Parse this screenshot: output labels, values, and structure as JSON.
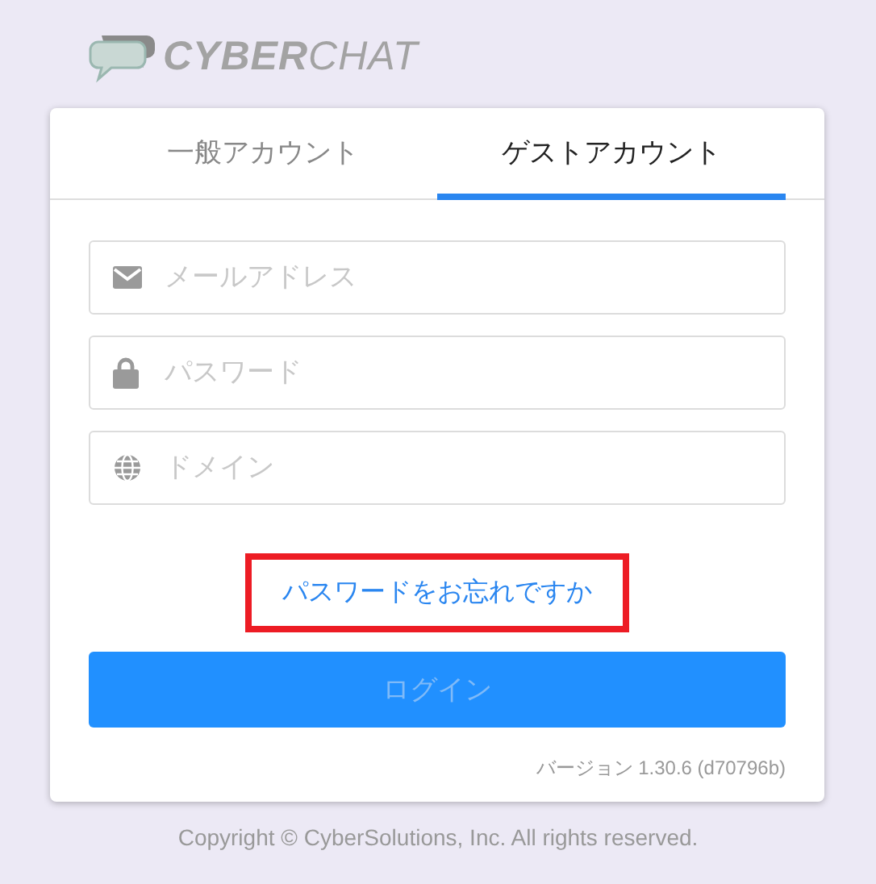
{
  "logo": {
    "text": "**CYBER**CHAT"
  },
  "tabs": [
    {
      "label": "一般アカウント",
      "selected": false
    },
    {
      "label": "ゲストアカウント",
      "selected": true
    }
  ],
  "fields": [
    {
      "kind": "email",
      "placeholder": "メールアドレス"
    },
    {
      "kind": "password",
      "placeholder": "パスワード"
    },
    {
      "kind": "domain",
      "placeholder": "ドメイン"
    }
  ],
  "forgot_link": {
    "text": "パスワードをお忘れですか",
    "highlighted": true
  },
  "login_button": {
    "label": "ログイン",
    "disabled": true
  },
  "version": "バージョン 1.30.6 (d70796b)",
  "copyright": "Copyright © CyberSolutions, Inc. All rights reserved."
}
